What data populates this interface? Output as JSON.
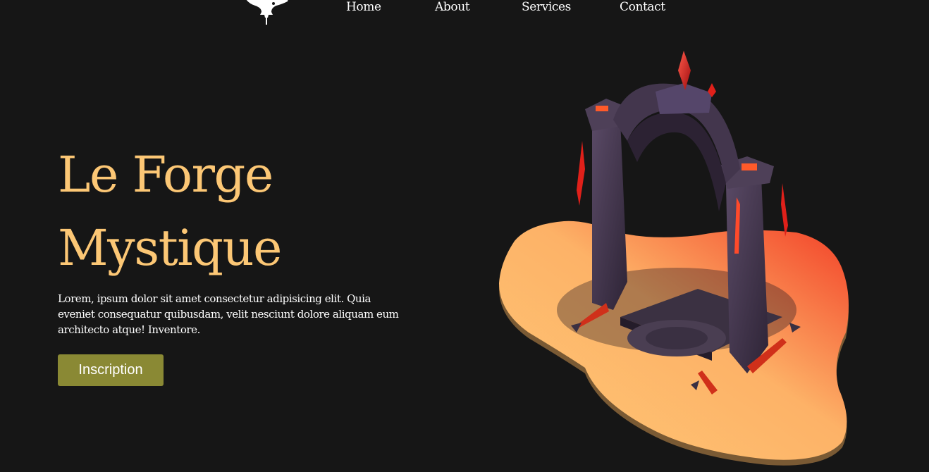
{
  "nav": {
    "items": [
      "Home",
      "About",
      "Services",
      "Contact"
    ]
  },
  "hero": {
    "title_line1": "Le Forge",
    "title_line2": "Mystique",
    "text": "Lorem, ipsum dolor sit amet consectetur adipisicing elit. Quia eveniet consequatur quibusdam, velit nesciunt dolore aliquam eum architecto atque! Inventore.",
    "cta_label": "Inscription"
  },
  "icons": {
    "logo": "anvil-icon",
    "illustration": "forge-portal-illustration"
  },
  "colors": {
    "background": "#161616",
    "title": "#fcc775",
    "button": "#8a8934",
    "text": "#ffffff",
    "island_light": "#fec877",
    "island_red": "#f23d26"
  }
}
